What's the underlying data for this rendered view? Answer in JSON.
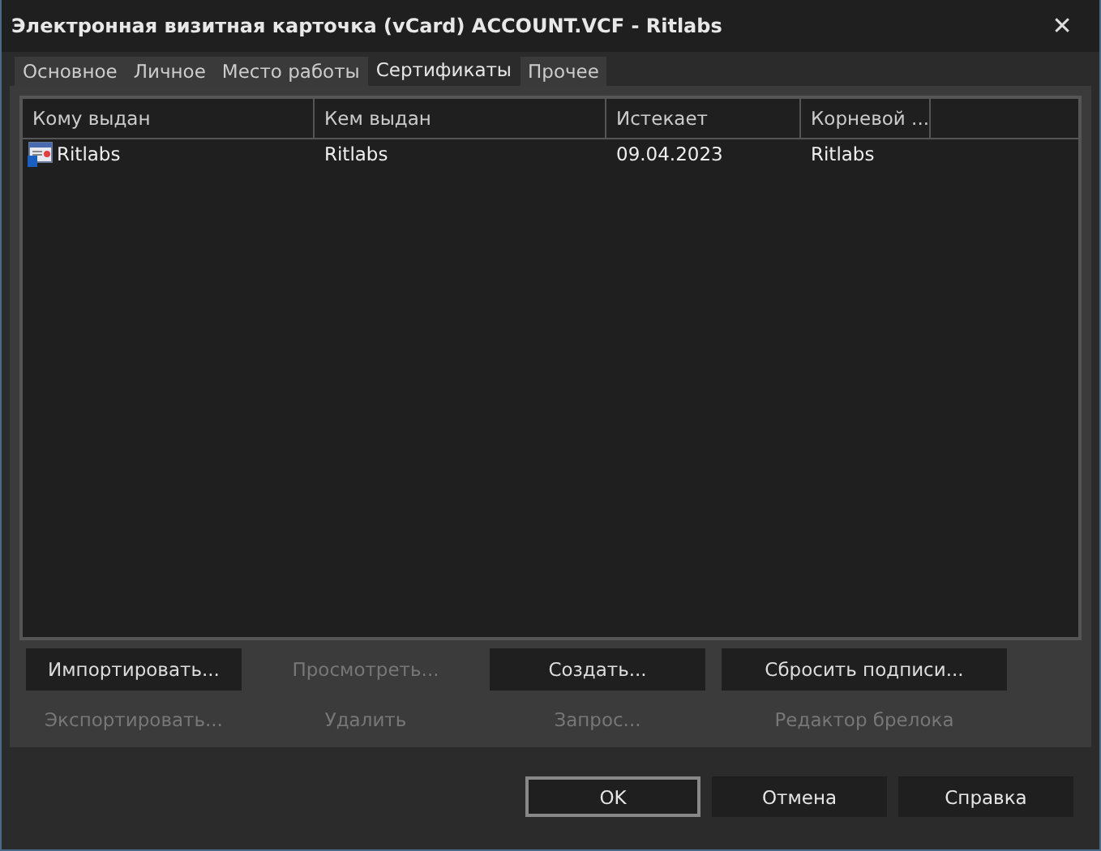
{
  "window": {
    "title": "Электронная визитная карточка (vCard) ACCOUNT.VCF - Ritlabs",
    "close": "✕"
  },
  "tabs": [
    {
      "label": "Основное",
      "selected": false
    },
    {
      "label": "Личное",
      "selected": false
    },
    {
      "label": "Место работы",
      "selected": false
    },
    {
      "label": "Сертификаты",
      "selected": true
    },
    {
      "label": "Прочее",
      "selected": false
    }
  ],
  "table": {
    "columns": [
      "Кому выдан",
      "Кем выдан",
      "Истекает",
      "Корневой ..."
    ],
    "rows": [
      {
        "cells": [
          "Ritlabs",
          "Ritlabs",
          "09.04.2023",
          "Ritlabs"
        ],
        "selected": false
      }
    ]
  },
  "cert_buttons": [
    {
      "label": "Импортировать...",
      "disabled": false
    },
    {
      "label": "Просмотреть...",
      "disabled": true
    },
    {
      "label": "Создать...",
      "disabled": false
    },
    {
      "label": "Сбросить подписи...",
      "disabled": false
    },
    {
      "label": "Экспортировать...",
      "disabled": true
    },
    {
      "label": "Удалить",
      "disabled": true
    },
    {
      "label": "Запрос...",
      "disabled": true
    },
    {
      "label": "Редактор брелока",
      "disabled": true
    }
  ],
  "dialog_buttons": [
    {
      "label": "OK",
      "default": true
    },
    {
      "label": "Отмена",
      "default": false
    },
    {
      "label": "Справка",
      "default": false
    }
  ]
}
